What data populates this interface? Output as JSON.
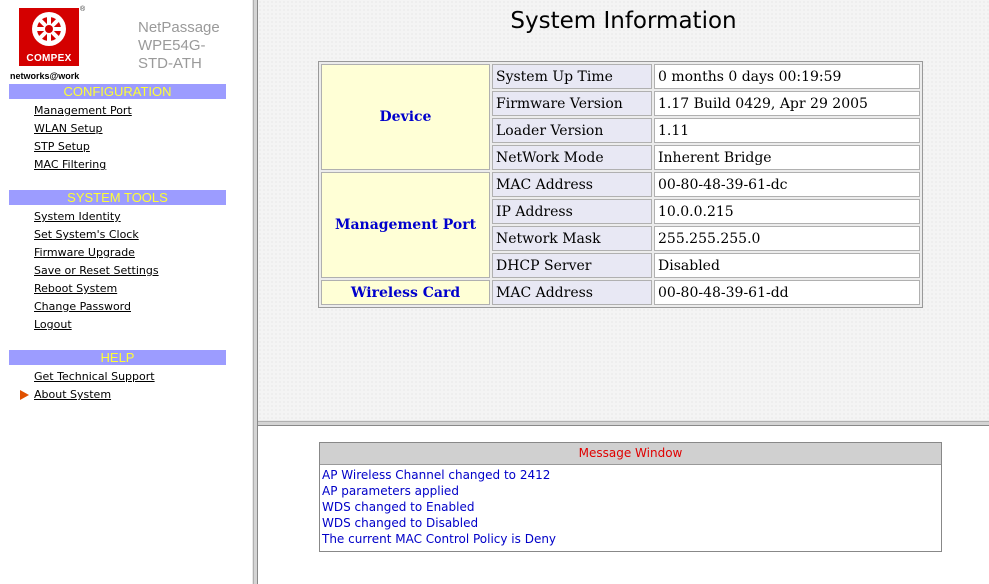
{
  "brand": {
    "logo_text": "COMPEX",
    "registered_mark": "®",
    "tagline": "networks@work",
    "product_lines": [
      "NetPassage",
      "WPE54G-",
      "STD-ATH"
    ]
  },
  "colors": {
    "section_bg": "#9c9cff",
    "section_text": "#ffff33",
    "group_bg": "#ffffd6",
    "group_text": "#0000cc",
    "message_text": "#0000c8",
    "message_title": "#e00000",
    "logo_red": "#d40000"
  },
  "sidebar": {
    "sections": [
      {
        "title": "CONFIGURATION",
        "links": [
          "Management Port",
          "WLAN Setup",
          "STP Setup",
          "MAC Filtering"
        ]
      },
      {
        "title": "SYSTEM TOOLS",
        "links": [
          "System Identity",
          "Set System's Clock",
          "Firmware Upgrade",
          "Save or Reset Settings",
          "Reboot System",
          "Change Password",
          "Logout"
        ]
      },
      {
        "title": "HELP",
        "links": [
          "Get Technical Support",
          "About System"
        ]
      }
    ],
    "current_item_icon": "right-arrow-icon"
  },
  "main": {
    "title": "System Information",
    "groups": [
      {
        "name": "Device",
        "rows": [
          {
            "label": "System Up Time",
            "value": "0 months 0 days 00:19:59"
          },
          {
            "label": "Firmware Version",
            "value": "1.17 Build 0429, Apr 29 2005"
          },
          {
            "label": "Loader Version",
            "value": "1.11"
          },
          {
            "label": "NetWork Mode",
            "value": "Inherent Bridge"
          }
        ]
      },
      {
        "name": "Management Port",
        "rows": [
          {
            "label": "MAC Address",
            "value": "00-80-48-39-61-dc"
          },
          {
            "label": "IP Address",
            "value": "10.0.0.215"
          },
          {
            "label": "Network Mask",
            "value": "255.255.255.0"
          },
          {
            "label": "DHCP Server",
            "value": "Disabled"
          }
        ]
      },
      {
        "name": "Wireless Card",
        "rows": [
          {
            "label": "MAC Address",
            "value": "00-80-48-39-61-dd"
          }
        ]
      }
    ]
  },
  "messages": {
    "title": "Message Window",
    "lines": [
      "AP Wireless Channel changed to 2412",
      "AP parameters applied",
      "WDS changed to Enabled",
      "WDS changed to Disabled",
      "The current MAC Control Policy is Deny"
    ]
  }
}
